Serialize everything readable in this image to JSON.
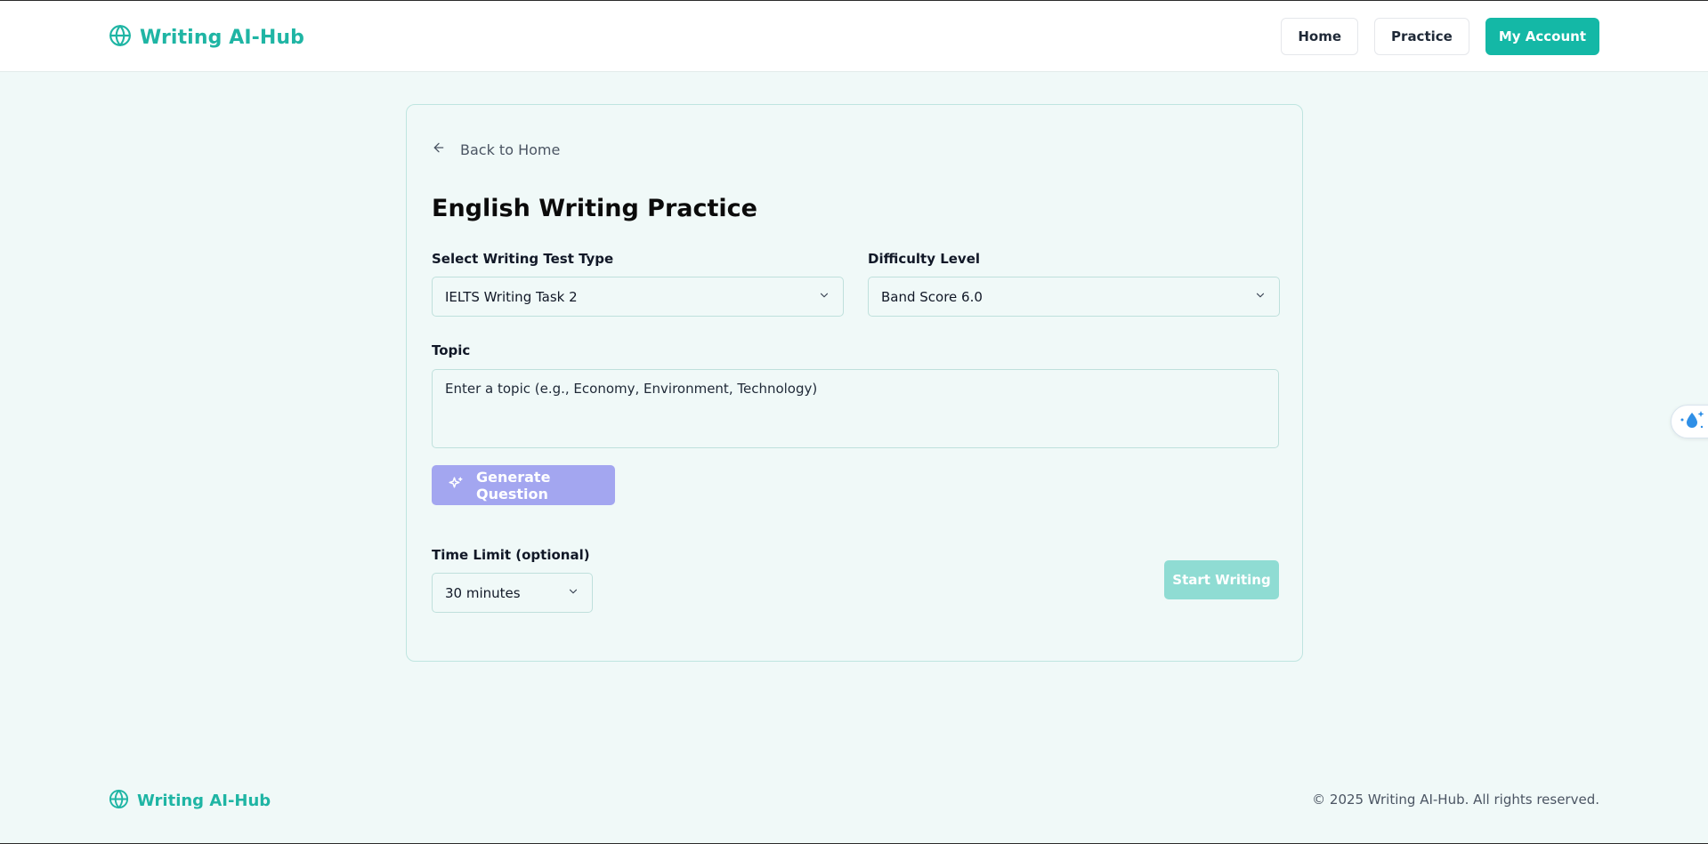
{
  "header": {
    "brand": "Writing AI-Hub",
    "nav": {
      "home": "Home",
      "practice": "Practice",
      "account": "My Account"
    }
  },
  "form": {
    "back_label": "Back to Home",
    "title": "English Writing Practice",
    "test_type": {
      "label": "Select Writing Test Type",
      "value": "IELTS Writing Task 2"
    },
    "difficulty": {
      "label": "Difficulty Level",
      "value": "Band Score 6.0"
    },
    "topic": {
      "label": "Topic",
      "placeholder": "Enter a topic (e.g., Economy, Environment, Technology)"
    },
    "generate_label": "Generate Question",
    "time_limit": {
      "label": "Time Limit (optional)",
      "value": "30 minutes"
    },
    "start_label": "Start Writing"
  },
  "footer": {
    "brand": "Writing AI-Hub",
    "copyright": "© 2025 Writing AI-Hub. All rights reserved."
  },
  "colors": {
    "accent": "#14b8a6",
    "generate_button": "#a3a6f0",
    "start_button_disabled": "#8fdcd3",
    "background": "#f0f9f8"
  },
  "icons": {
    "brand": "globe-icon",
    "back": "arrow-left-icon",
    "select": "chevron-down-icon",
    "generate": "sparkles-icon",
    "widget": "droplet-sparkle-icon"
  }
}
